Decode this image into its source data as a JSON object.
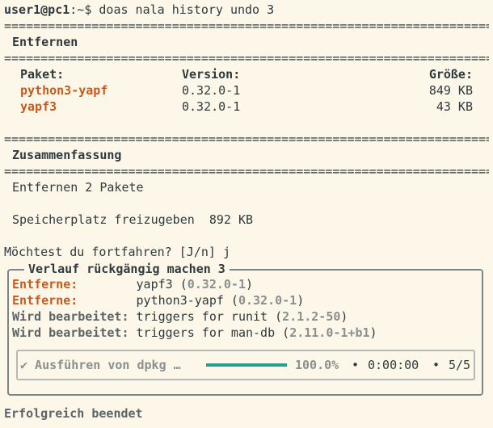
{
  "prompt": {
    "user_host": "user1@pc1",
    "path_sep": ":~$",
    "command": " doas nala history undo 3"
  },
  "rules": {
    "double": "=================================================================================================="
  },
  "remove_section": {
    "title": "Entfernen",
    "headers": {
      "package": "Paket:",
      "version": "Version:",
      "size": "Größe:"
    },
    "rows": [
      {
        "package": "python3-yapf",
        "version": "0.32.0-1",
        "size": "849 KB"
      },
      {
        "package": "yapf3",
        "version": "0.32.0-1",
        "size": "43 KB"
      }
    ]
  },
  "summary_section": {
    "title": "Zusammenfassung",
    "remove_line": "Entfernen 2 Pakete",
    "free_space_line": "Speicherplatz freizugeben  892 KB"
  },
  "confirm": {
    "question": "Möchtest du fortfahren? [J/n] ",
    "answer": "j"
  },
  "history_panel": {
    "title": "Verlauf rückgängig machen 3",
    "lines": [
      {
        "label": "Entferne:",
        "pad": "        ",
        "text": "yapf3 (",
        "version": "0.32.0-1",
        "close": ")"
      },
      {
        "label": "Entferne:",
        "pad": "        ",
        "text": "python3-yapf (",
        "version": "0.32.0-1",
        "close": ")"
      },
      {
        "label": "Wird bearbeitet:",
        "pad": " ",
        "text": "triggers for runit (",
        "version": "2.1.2-50",
        "close": ")"
      },
      {
        "label": "Wird bearbeitet:",
        "pad": " ",
        "text": "triggers for man-db (",
        "version": "2.11.0-1+b1",
        "close": ")"
      }
    ],
    "progress": {
      "label": "✔ Ausführen von dpkg …",
      "percent_text": "100.0%",
      "fraction": 1.0,
      "elapsed": "0:00:00",
      "count": "5/5",
      "bar_color": "#2a9d8f"
    }
  },
  "footer": {
    "status": "Erfolgreich beendet"
  },
  "colors": {
    "package": "#c85a1e",
    "background": "#fcf7e8",
    "text": "#2f3a3f"
  }
}
